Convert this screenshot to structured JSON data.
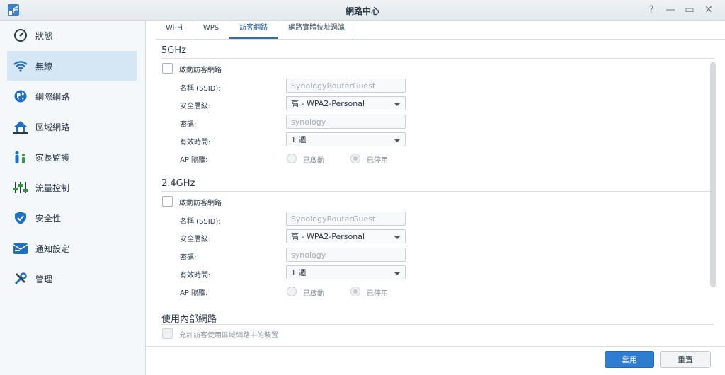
{
  "window": {
    "title": "網路中心",
    "controls": [
      "help-icon",
      "minimize-icon",
      "maximize-icon",
      "close-icon"
    ],
    "help_glyph": "?",
    "minimize_glyph": "—",
    "maximize_glyph": "▭",
    "close_glyph": "✕"
  },
  "sidebar": {
    "items": [
      {
        "label": "狀態",
        "icon": "gauge-icon"
      },
      {
        "label": "無線",
        "icon": "wifi-icon",
        "active": true
      },
      {
        "label": "網際網路",
        "icon": "globe-icon"
      },
      {
        "label": "區域網路",
        "icon": "home-network-icon"
      },
      {
        "label": "家長監護",
        "icon": "family-icon"
      },
      {
        "label": "流量控制",
        "icon": "sliders-icon"
      },
      {
        "label": "安全性",
        "icon": "shield-icon"
      },
      {
        "label": "通知設定",
        "icon": "notification-icon"
      },
      {
        "label": "管理",
        "icon": "tools-icon"
      }
    ]
  },
  "tabs": [
    {
      "label": "Wi-Fi"
    },
    {
      "label": "WPS"
    },
    {
      "label": "訪客網路",
      "active": true
    },
    {
      "label": "網路實體位址過濾"
    }
  ],
  "band5": {
    "title": "5GHz",
    "enable_label": "啟動訪客網路",
    "ssid_label": "名稱 (SSID):",
    "ssid_value": "SynologyRouterGuest",
    "security_label": "安全層級:",
    "security_value": "高 - WPA2-Personal",
    "password_label": "密碼:",
    "password_value": "synology",
    "validity_label": "有效時間:",
    "validity_value": "1 週",
    "ap_label": "AP 隔離:",
    "ap_on_label": "已啟動",
    "ap_off_label": "已停用"
  },
  "band24": {
    "title": "2.4GHz",
    "enable_label": "啟動訪客網路",
    "ssid_label": "名稱 (SSID):",
    "ssid_value": "SynologyRouterGuest",
    "security_label": "安全層級:",
    "security_value": "高 - WPA2-Personal",
    "password_label": "密碼:",
    "password_value": "synology",
    "validity_label": "有效時間:",
    "validity_value": "1 週",
    "ap_label": "AP 隔離:",
    "ap_on_label": "已啟動",
    "ap_off_label": "已停用"
  },
  "lan": {
    "title": "使用內部網路",
    "allow_label": "允許訪客使用區域網路中的裝置"
  },
  "buttons": {
    "apply": "套用",
    "reset": "重置"
  },
  "colors": {
    "accent": "#2f7dd0",
    "sidebar_active": "#d5e6f5",
    "icon_blue": "#1f6fc5"
  }
}
